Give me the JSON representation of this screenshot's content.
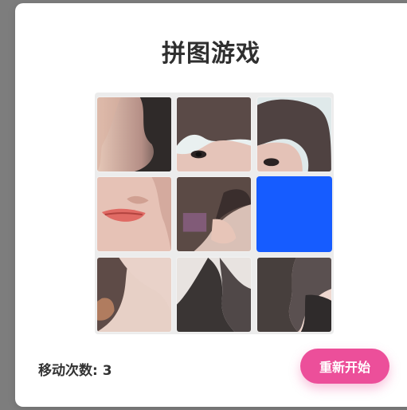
{
  "modal": {
    "title": "拼图游戏"
  },
  "board": {
    "tiles": [
      {
        "row": 0,
        "col": 0,
        "icon": "puzzle-photo-tile"
      },
      {
        "row": 0,
        "col": 1,
        "icon": "puzzle-photo-tile"
      },
      {
        "row": 0,
        "col": 2,
        "icon": "puzzle-photo-tile"
      },
      {
        "row": 1,
        "col": 0,
        "icon": "puzzle-photo-tile"
      },
      {
        "row": 1,
        "col": 1,
        "icon": "puzzle-photo-tile"
      },
      {
        "row": 1,
        "col": 2,
        "icon": "empty-slot",
        "color": "#165cff"
      },
      {
        "row": 2,
        "col": 0,
        "icon": "puzzle-photo-tile"
      },
      {
        "row": 2,
        "col": 1,
        "icon": "puzzle-photo-tile"
      },
      {
        "row": 2,
        "col": 2,
        "icon": "puzzle-photo-tile"
      }
    ],
    "empty_color": "#165cff"
  },
  "footer": {
    "moves_label": "移动次数: 3",
    "restart_label": "重新开始"
  },
  "colors": {
    "overlay": "#7d7d7d",
    "accent_pink": "#ec4f9a",
    "empty_tile_blue": "#165cff"
  }
}
